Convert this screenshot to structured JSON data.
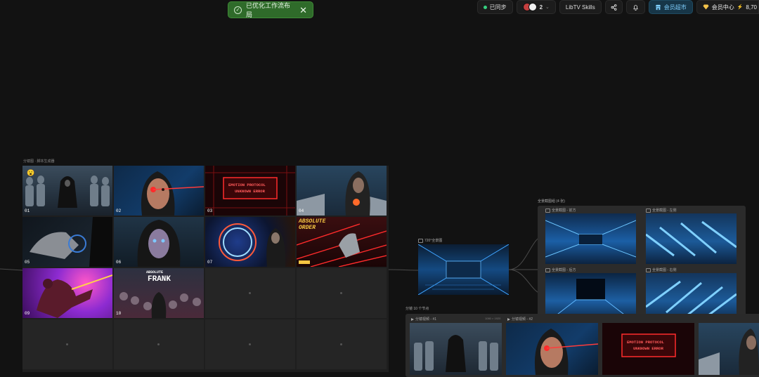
{
  "toast": {
    "message": "已优化工作流布局",
    "icon": "check-circle-icon",
    "close": "✕"
  },
  "topbar": {
    "sync": "已同步",
    "collab_count": "2",
    "caret": "⌄",
    "skills": "LibTV Skills",
    "shop": "会员超市",
    "vip": "会员中心",
    "credits": "8,70",
    "bolt": "⚡"
  },
  "storyboard": {
    "label": "分镜图 · 脚本生成器",
    "cells": [
      {
        "num": "01"
      },
      {
        "num": "02"
      },
      {
        "num": "03",
        "text1": "EMOTION PROTOCOL",
        "text2": "UNKNOWN ERROR"
      },
      {
        "num": "04"
      },
      {
        "num": "05"
      },
      {
        "num": "06"
      },
      {
        "num": "07"
      },
      {
        "num": "08",
        "text1": "ABSOLUTE",
        "text2": "ORDER"
      },
      {
        "num": "09"
      },
      {
        "num": "10",
        "text1": "ABSOLUTE",
        "text2": "FRANK"
      }
    ],
    "emoji": "😮"
  },
  "env_node": {
    "label": "720°全景图"
  },
  "split_group": {
    "label": "全景截图组 (4 张)",
    "items": [
      "全景截图 - 前方",
      "全景截图 - 左侧",
      "全景截图 - 后方",
      "全景截图 - 右侧"
    ]
  },
  "sequence": {
    "label": "分镜 10 个节点",
    "items": [
      "分镜视频 - #1",
      "分镜视频 - #2"
    ],
    "meta": "1080 × 1920",
    "t3_line1": "EMOTION PROTOCOL",
    "t3_line2": "UNKNOWN ERROR"
  }
}
